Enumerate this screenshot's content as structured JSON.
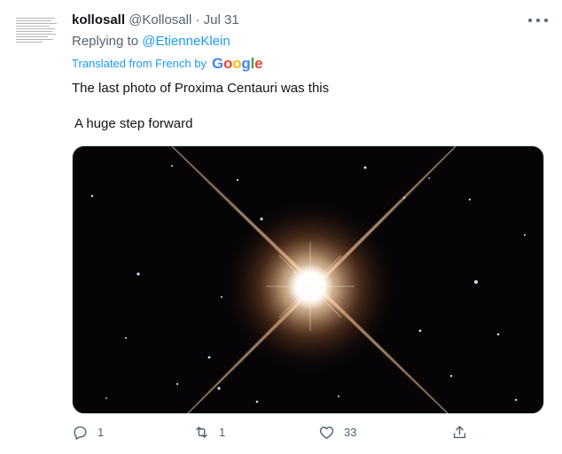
{
  "tweet": {
    "author_name": "kollosall",
    "author_handle": "@Kollosall",
    "separator": "·",
    "date": "Jul 31",
    "reply_prefix": "Replying to",
    "reply_to": "@EtienneKlein",
    "translated_label": "Translated from French by",
    "translator_brand": "Google",
    "text_line1": "The last photo of Proxima Centauri was this",
    "text_line2": "A huge step forward",
    "image_subject": "Proxima Centauri star photo"
  },
  "actions": {
    "reply_count": "1",
    "retweet_count": "1",
    "like_count": "33"
  },
  "icons": {
    "more": "more-horizontal-icon",
    "reply": "reply-icon",
    "retweet": "retweet-icon",
    "like": "heart-icon",
    "share": "share-icon"
  },
  "colors": {
    "link": "#1d9bf0",
    "muted": "#536471",
    "text": "#0f1419"
  }
}
